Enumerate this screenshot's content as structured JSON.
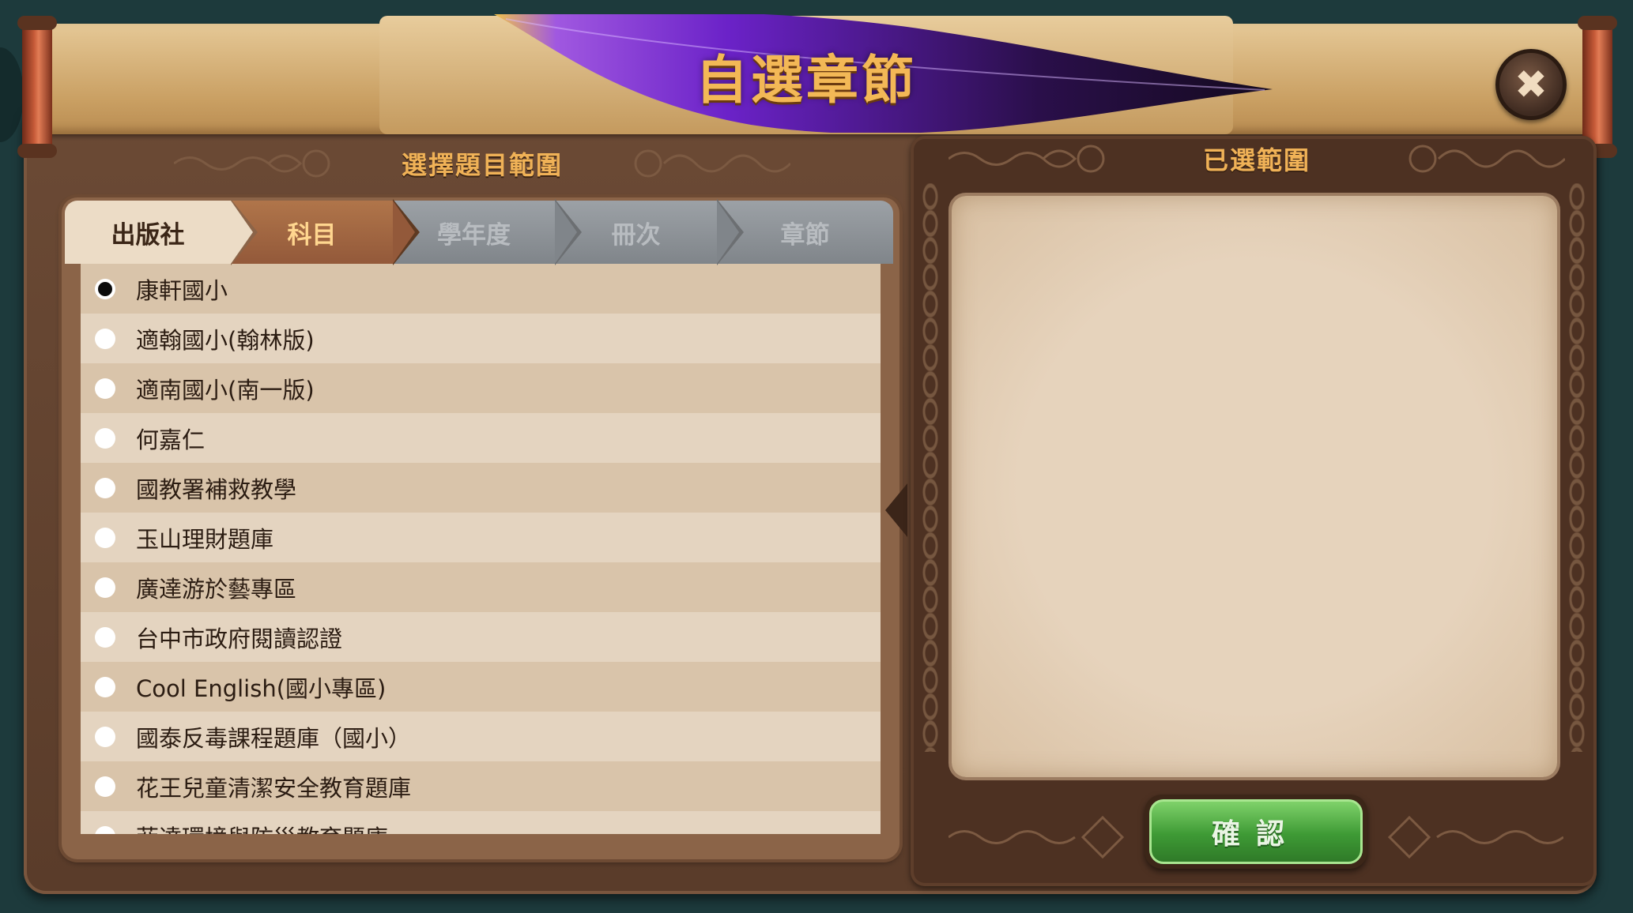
{
  "dialog": {
    "title": "自選章節",
    "close_label": "✖"
  },
  "left_panel": {
    "header": "選擇題目範圍",
    "tabs": [
      {
        "label": "出版社",
        "state": "done"
      },
      {
        "label": "科目",
        "state": "active"
      },
      {
        "label": "學年度",
        "state": "pending"
      },
      {
        "label": "冊次",
        "state": "pending"
      },
      {
        "label": "章節",
        "state": "pending"
      }
    ],
    "publishers": [
      {
        "label": "康軒國小",
        "selected": true
      },
      {
        "label": "適翰國小(翰林版)",
        "selected": false
      },
      {
        "label": "適南國小(南一版)",
        "selected": false
      },
      {
        "label": "何嘉仁",
        "selected": false
      },
      {
        "label": "國教署補救教學",
        "selected": false
      },
      {
        "label": "玉山理財題庫",
        "selected": false
      },
      {
        "label": "廣達游於藝專區",
        "selected": false
      },
      {
        "label": "台中市政府閱讀認證",
        "selected": false
      },
      {
        "label": "Cool English(國小專區)",
        "selected": false
      },
      {
        "label": "國泰反毒課程題庫（國小）",
        "selected": false
      },
      {
        "label": "花王兒童清潔安全教育題庫",
        "selected": false
      },
      {
        "label": "菲達環境與防災教育題庫",
        "selected": false
      }
    ]
  },
  "right_panel": {
    "header": "已選範圍",
    "confirm_label": "確認"
  },
  "colors": {
    "title": "#f3b856",
    "active_tab": "#93593a",
    "pending_tab": "#80858a",
    "confirm_green": "#3e9a35"
  }
}
